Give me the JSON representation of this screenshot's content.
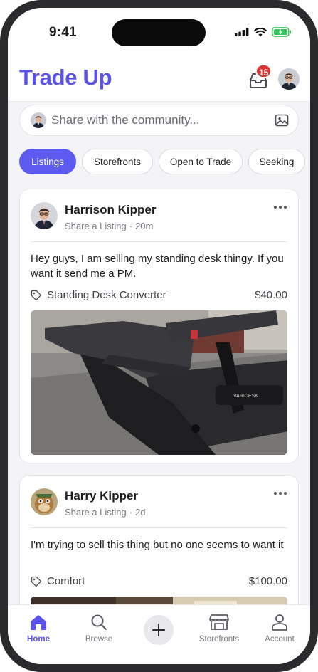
{
  "status_bar": {
    "time": "9:41"
  },
  "header": {
    "title": "Trade Up",
    "inbox_count": "15"
  },
  "composer": {
    "placeholder": "Share with the community..."
  },
  "filters": [
    {
      "label": "Listings",
      "active": true
    },
    {
      "label": "Storefronts",
      "active": false
    },
    {
      "label": "Open to Trade",
      "active": false
    },
    {
      "label": "Seeking",
      "active": false
    }
  ],
  "posts": [
    {
      "author": "Harrison Kipper",
      "action": "Share a Listing",
      "separator": "·",
      "time": "20m",
      "text": "Hey guys, I am selling my standing desk thingy. If you want it send me a PM.",
      "item": "Standing Desk Converter",
      "price": "$40.00"
    },
    {
      "author": "Harry Kipper",
      "action": "Share a Listing",
      "separator": "·",
      "time": "2d",
      "text": "I'm trying to sell this thing but no one seems to want it",
      "item": "Comfort",
      "price": "$100.00"
    }
  ],
  "tabs": {
    "home": "Home",
    "browse": "Browse",
    "storefronts": "Storefronts",
    "account": "Account"
  },
  "colors": {
    "brand": "#5b52ec",
    "badge": "#e0322d",
    "chip_active": "#5b5bf0",
    "battery": "#34c759"
  },
  "icons": [
    "inbox-icon",
    "image-icon",
    "tag-icon",
    "more-icon",
    "home-icon",
    "search-icon",
    "plus-icon",
    "store-icon",
    "person-icon"
  ]
}
